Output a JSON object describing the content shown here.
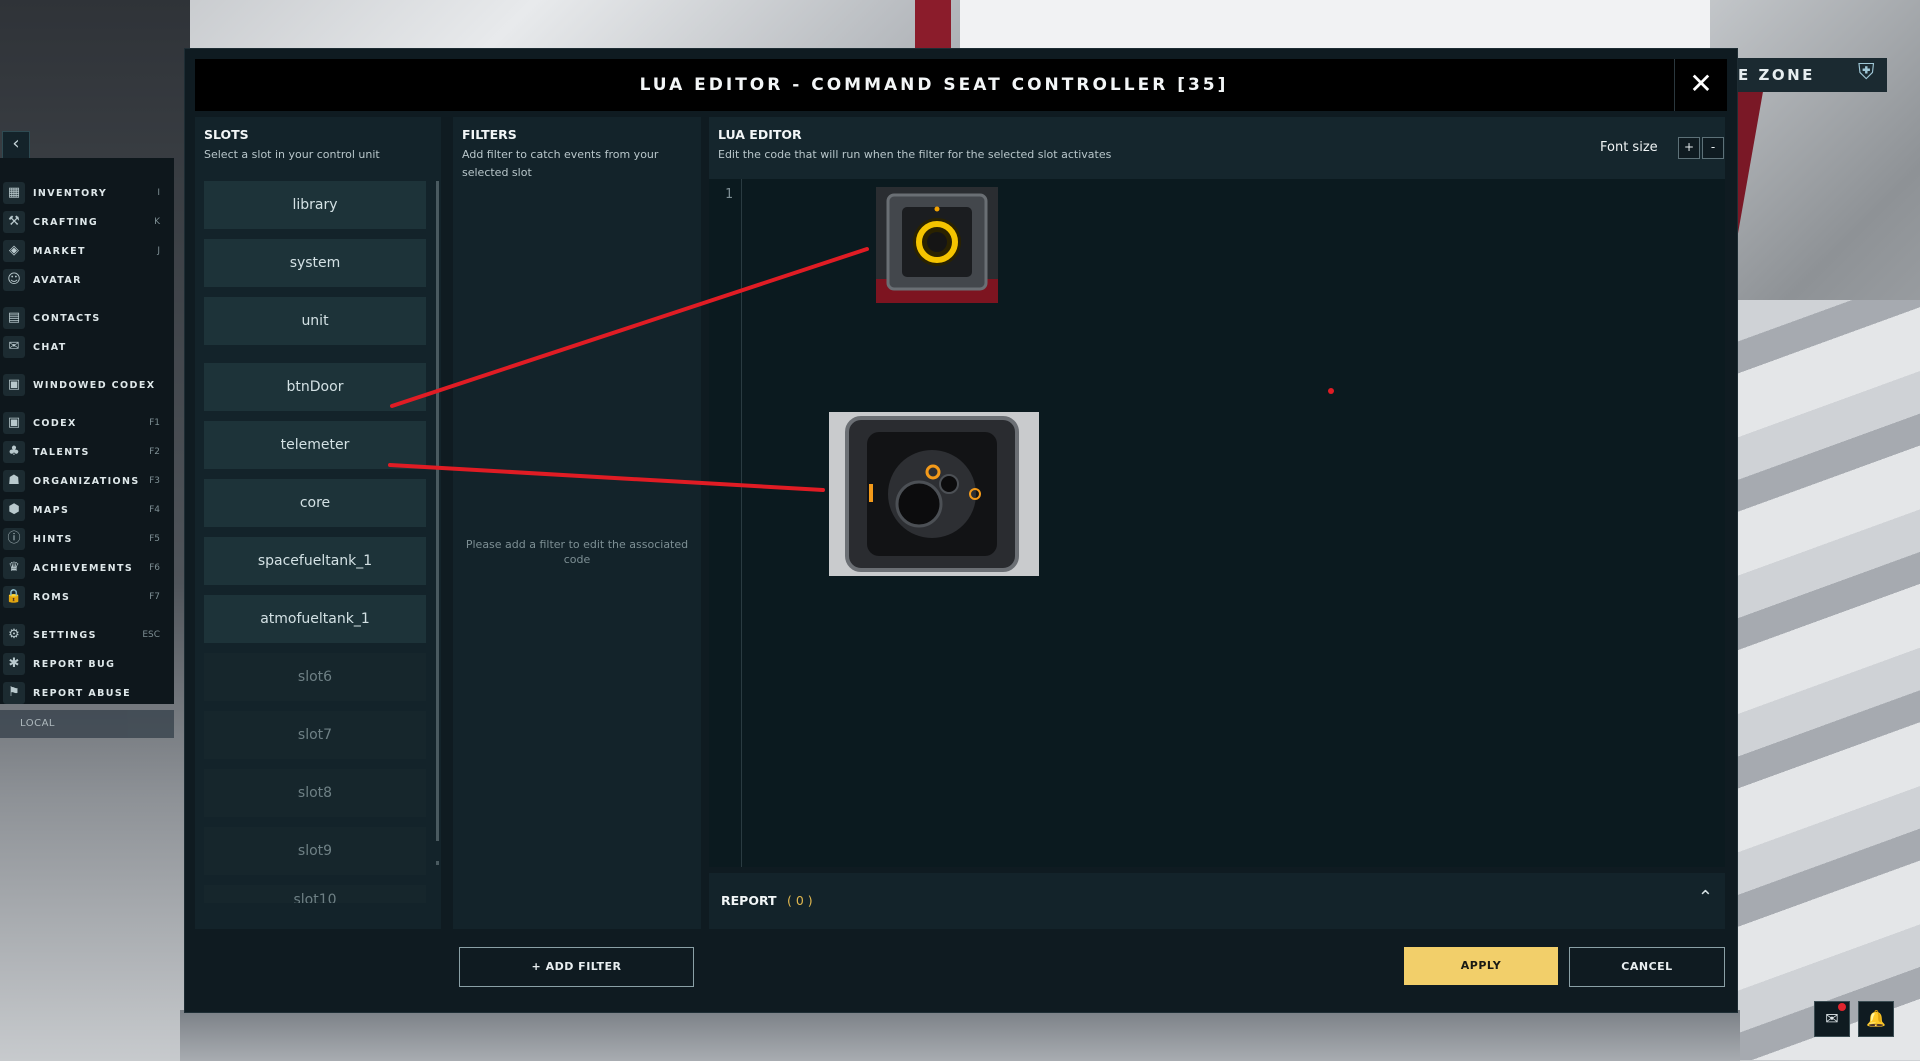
{
  "window": {
    "title": "LUA EDITOR - COMMAND SEAT CONTROLLER [35]",
    "close_glyph": "✕"
  },
  "background": {
    "zone_label": "E ZONE"
  },
  "game_menu": {
    "back_glyph": "‹",
    "items": [
      {
        "label": "INVENTORY",
        "key": "I",
        "icon": "▦"
      },
      {
        "label": "CRAFTING",
        "key": "K",
        "icon": "⚒"
      },
      {
        "label": "MARKET",
        "key": "J",
        "icon": "◈"
      },
      {
        "label": "AVATAR",
        "key": "",
        "icon": "☺"
      },
      {
        "label": "CONTACTS",
        "key": "",
        "icon": "▤"
      },
      {
        "label": "CHAT",
        "key": "",
        "icon": "✉"
      },
      {
        "label": "WINDOWED CODEX",
        "key": "",
        "icon": "▣"
      },
      {
        "label": "CODEX",
        "key": "F1",
        "icon": "▣"
      },
      {
        "label": "TALENTS",
        "key": "F2",
        "icon": "♣"
      },
      {
        "label": "ORGANIZATIONS",
        "key": "F3",
        "icon": "☗"
      },
      {
        "label": "MAPS",
        "key": "F4",
        "icon": "⬢"
      },
      {
        "label": "HINTS",
        "key": "F5",
        "icon": "ⓘ"
      },
      {
        "label": "ACHIEVEMENTS",
        "key": "F6",
        "icon": "♛"
      },
      {
        "label": "ROMS",
        "key": "F7",
        "icon": "🔒"
      },
      {
        "label": "SETTINGS",
        "key": "ESC",
        "icon": "⚙"
      },
      {
        "label": "REPORT BUG",
        "key": "",
        "icon": "✱"
      },
      {
        "label": "REPORT ABUSE",
        "key": "",
        "icon": "⚑"
      }
    ],
    "local_label": "LOCAL"
  },
  "slots": {
    "title": "SLOTS",
    "subtitle": "Select a slot in your control unit",
    "items": [
      {
        "label": "library",
        "empty": false
      },
      {
        "label": "system",
        "empty": false
      },
      {
        "label": "unit",
        "empty": false
      },
      {
        "label": "btnDoor",
        "empty": false
      },
      {
        "label": "telemeter",
        "empty": false
      },
      {
        "label": "core",
        "empty": false
      },
      {
        "label": "spacefueltank_1",
        "empty": false
      },
      {
        "label": "atmofueltank_1",
        "empty": false
      },
      {
        "label": "slot6",
        "empty": true
      },
      {
        "label": "slot7",
        "empty": true
      },
      {
        "label": "slot8",
        "empty": true
      },
      {
        "label": "slot9",
        "empty": true
      },
      {
        "label": "slot10",
        "empty": true
      }
    ]
  },
  "filters": {
    "title": "FILTERS",
    "subtitle": "Add filter to catch events from your selected slot",
    "empty_message": "Please add a filter to edit the associated code",
    "add_button": "+ ADD FILTER"
  },
  "editor": {
    "title": "LUA EDITOR",
    "subtitle": "Edit the code that will run when the filter for the selected slot activates",
    "font_size_label": "Font size",
    "font_plus": "+",
    "font_minus": "-",
    "line_number": "1"
  },
  "report": {
    "label": "REPORT",
    "count": "( 0 )",
    "chevron": "⌃"
  },
  "actions": {
    "apply": "APPLY",
    "cancel": "CANCEL"
  },
  "hud": {
    "chat_icon": "✉",
    "bell_icon": "🔔"
  },
  "colors": {
    "accent_yellow": "#f2cf6a",
    "annotation_red": "#e01c24"
  }
}
